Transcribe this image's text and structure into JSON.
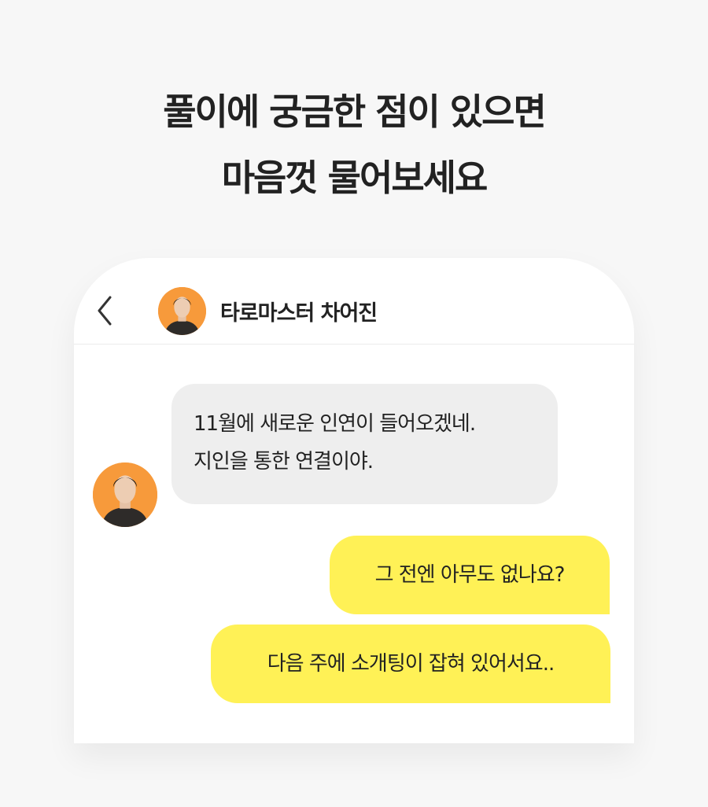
{
  "headline": {
    "line1": "풀이에 궁금한 점이 있으면",
    "line2": "마음껏 물어보세요"
  },
  "chat": {
    "header": {
      "back_icon": "chevron-left-icon",
      "contact_name": "타로마스터 차어진"
    },
    "messages": [
      {
        "sender": "master",
        "lines": [
          "11월에 새로운 인연이 들어오겠네.",
          "지인을 통한 연결이야."
        ]
      },
      {
        "sender": "user",
        "text": "그 전엔 아무도 없나요?"
      },
      {
        "sender": "user",
        "text": "다음 주에 소개팅이 잡혀 있어서요.."
      }
    ]
  },
  "colors": {
    "background": "#f7f7f7",
    "incoming_bubble": "#eeeeee",
    "outgoing_bubble": "#fff156",
    "avatar_background": "#f79a3b",
    "text": "#222222"
  }
}
